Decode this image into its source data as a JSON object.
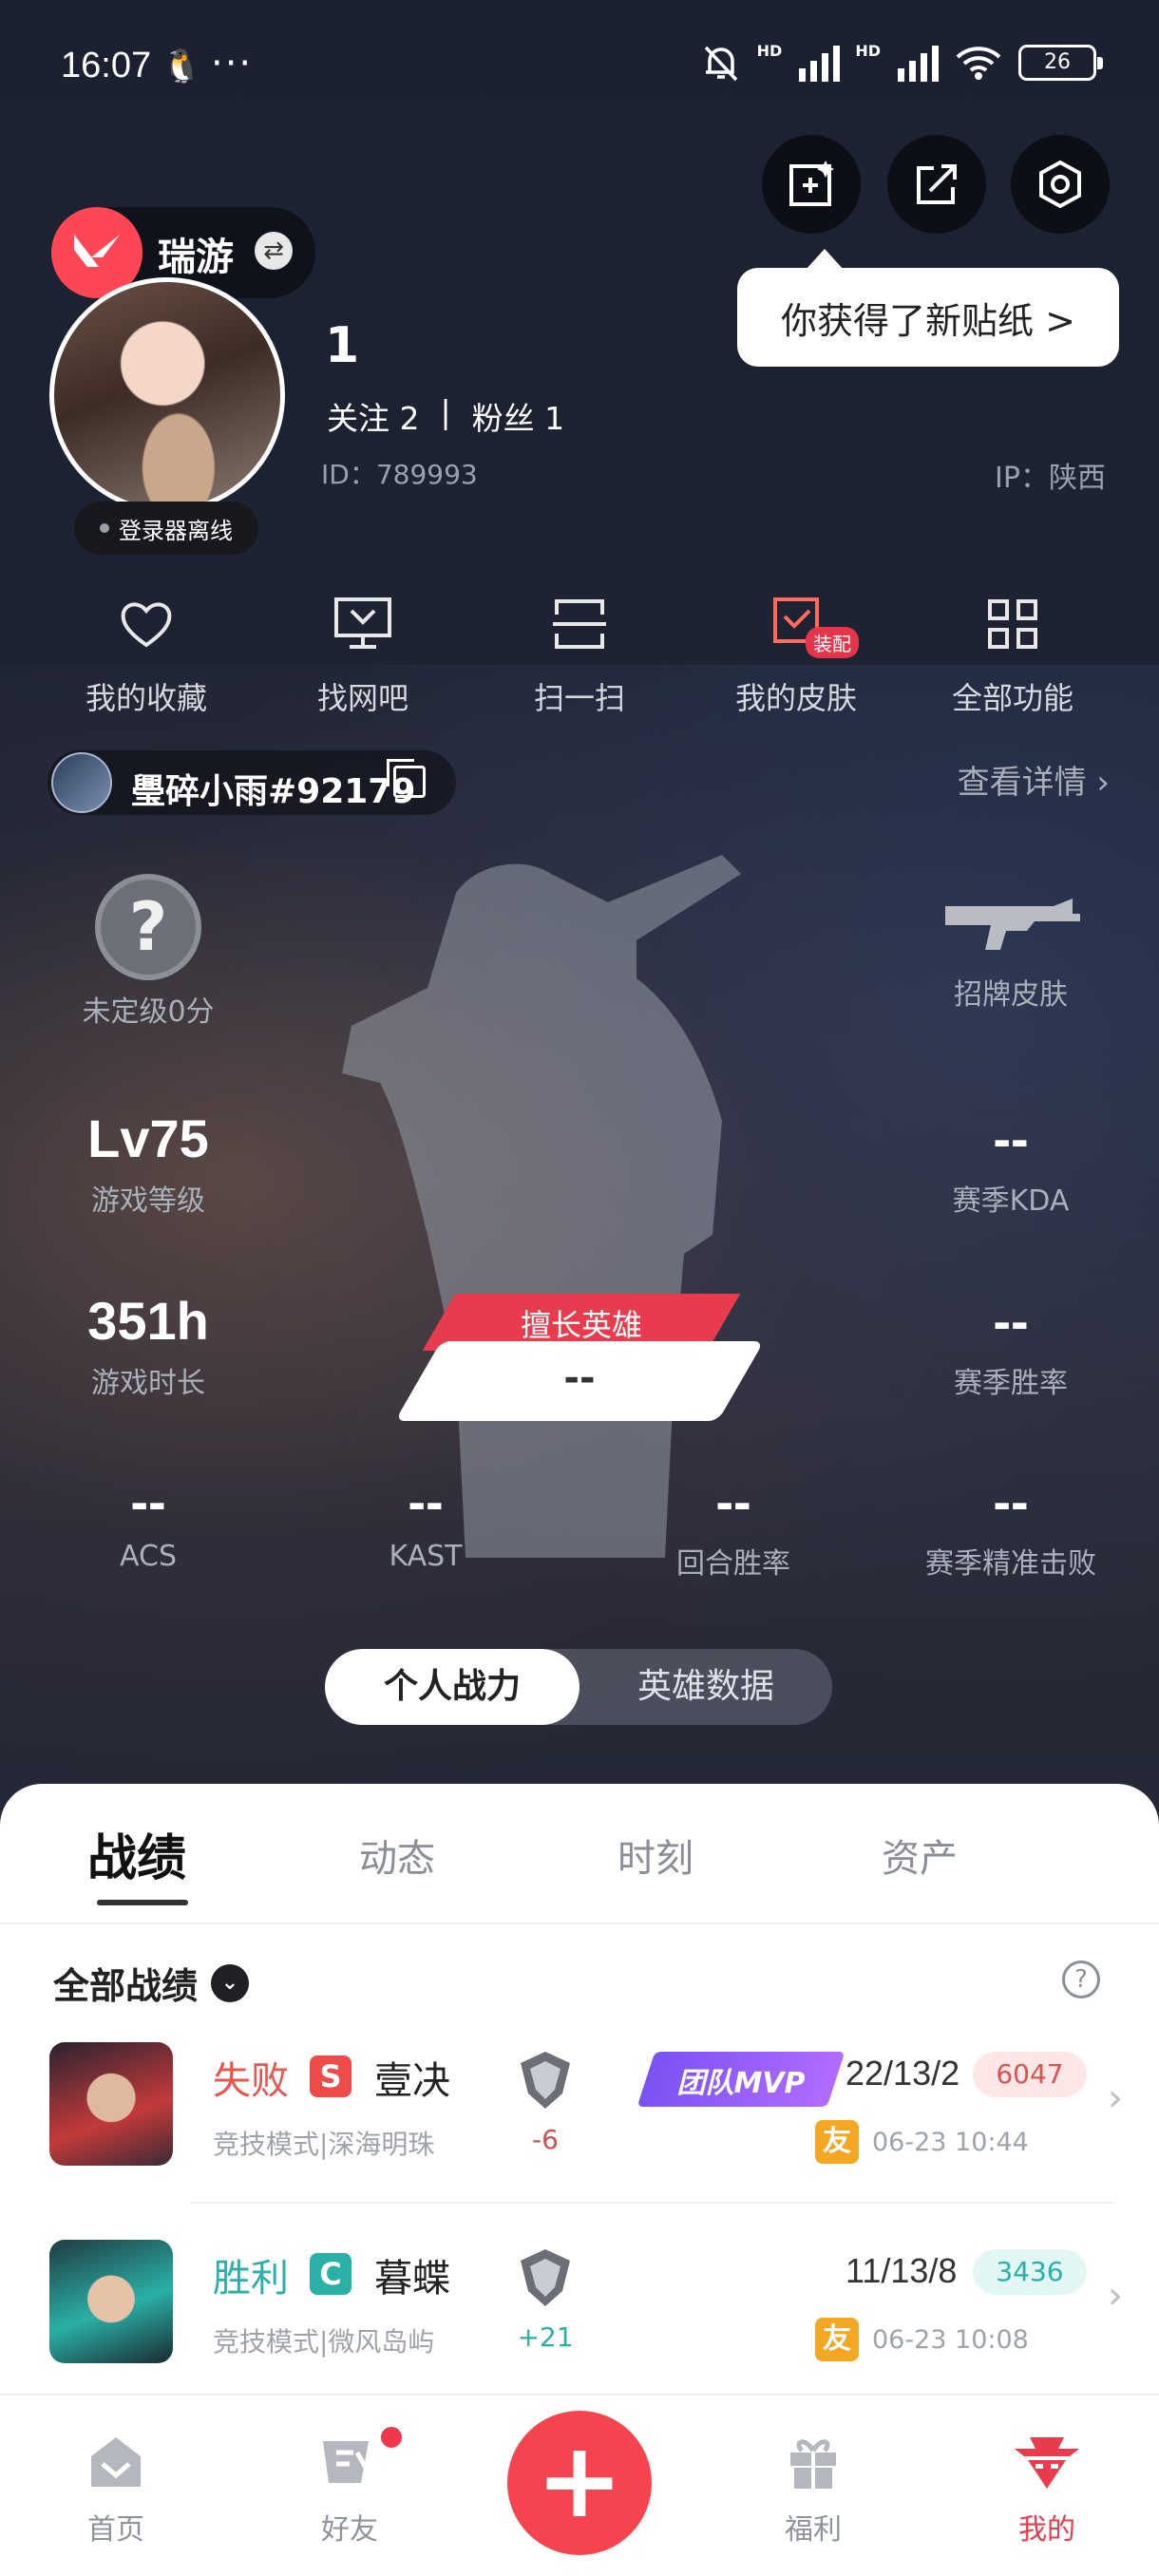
{
  "status_bar": {
    "time": "16:07",
    "network": "HD",
    "wifi_sub": "6",
    "battery": "26"
  },
  "header": {
    "sticker_bubble": "你获得了新贴纸 >"
  },
  "game": {
    "name": "瑞游"
  },
  "profile": {
    "username": "1",
    "following": "关注 2",
    "separator": "|",
    "followers": "粉丝 1",
    "id": "ID：789993",
    "ip": "IP：陕西",
    "login_status": "登录器离线"
  },
  "quick_actions": [
    {
      "label": "我的收藏",
      "icon": "heart-icon"
    },
    {
      "label": "找网吧",
      "icon": "monitor-icon"
    },
    {
      "label": "扫一扫",
      "icon": "scan-icon"
    },
    {
      "label": "我的皮肤",
      "icon": "skin-icon",
      "tag": "装配"
    },
    {
      "label": "全部功能",
      "icon": "grid-icon"
    }
  ],
  "player": {
    "tag": "璺碎小雨#92179",
    "detail_link": "查看详情"
  },
  "stats": {
    "rank": {
      "label": "未定级0分",
      "icon": "question-icon"
    },
    "signature_skin": {
      "label": "招牌皮肤",
      "icon": "gun-icon"
    },
    "level": {
      "value": "Lv75",
      "label": "游戏等级"
    },
    "season_kda": {
      "value": "--",
      "label": "赛季KDA"
    },
    "playtime": {
      "value": "351h",
      "label": "游戏时长"
    },
    "season_winrate": {
      "value": "--",
      "label": "赛季胜率"
    },
    "best_hero": {
      "title": "擅长英雄",
      "value": "--"
    },
    "acs": {
      "value": "--",
      "label": "ACS"
    },
    "kast": {
      "value": "--",
      "label": "KAST"
    },
    "round_winrate": {
      "value": "--",
      "label": "回合胜率"
    },
    "season_precise": {
      "value": "--",
      "label": "赛季精准击败"
    }
  },
  "segmented": {
    "active": "个人战力",
    "inactive": "英雄数据"
  },
  "tabs": [
    "战绩",
    "动态",
    "时刻",
    "资产"
  ],
  "filter": {
    "label": "全部战绩",
    "help": "?"
  },
  "matches": [
    {
      "result": "失败",
      "result_color": "#e8554f",
      "mode_badge": "S",
      "badge_color": "#ef4b4b",
      "map_title": "壹决",
      "subtitle": "竞技模式|深海明珠",
      "delta": "-6",
      "delta_color": "#c9504c",
      "mvp": "团队MVP",
      "kda": "22/13/2",
      "score": "6047",
      "score_bg": "#fde6e6",
      "score_color": "#d9534f",
      "friend": "友",
      "time": "06-23 10:44"
    },
    {
      "result": "胜利",
      "result_color": "#2ab0a6",
      "mode_badge": "C",
      "badge_color": "#2ab0a6",
      "map_title": "暮蝶",
      "subtitle": "竞技模式|微风岛屿",
      "delta": "+21",
      "delta_color": "#2ab0a6",
      "mvp": "",
      "kda": "11/13/8",
      "score": "3436",
      "score_bg": "#e2f6f4",
      "score_color": "#2ab0a6",
      "friend": "友",
      "time": "06-23 10:08"
    }
  ],
  "nav": [
    {
      "label": "首页",
      "icon": "home-icon"
    },
    {
      "label": "好友",
      "icon": "friends-icon"
    },
    {
      "label": "+",
      "icon": "plus-icon"
    },
    {
      "label": "福利",
      "icon": "gift-icon"
    },
    {
      "label": "我的",
      "icon": "profile-icon"
    }
  ]
}
